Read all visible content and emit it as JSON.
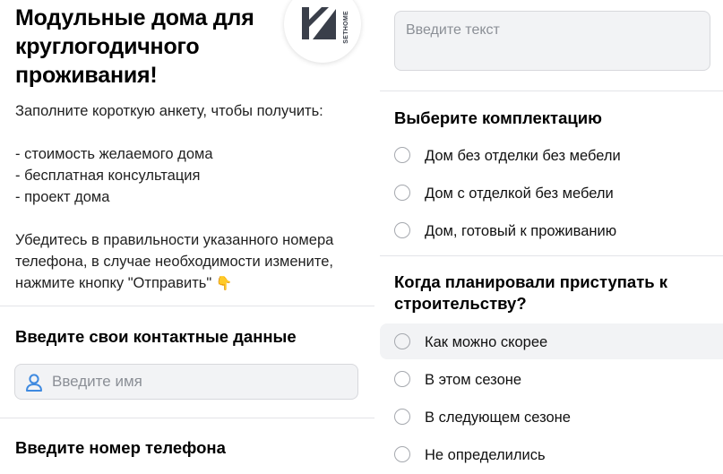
{
  "header": {
    "title": "Модульные дома для круглогодичного проживания!",
    "logo_text": "SETHOME",
    "logo_icon": "sethome-logo-icon"
  },
  "intro": {
    "lead": "Заполните короткую анкету, чтобы получить:",
    "bullets": [
      "- стоимость желаемого дома",
      "- бесплатная консультация",
      "- проект дома"
    ],
    "note": "Убедитесь в правильности указанного номера телефона, в случае необходимости измените, нажмите кнопку \"Отправить\"",
    "note_emoji": "👇"
  },
  "contact": {
    "title": "Введите свои контактные данные",
    "name_placeholder": "Введите имя",
    "name_icon": "user-icon"
  },
  "phone": {
    "title": "Введите номер телефона"
  },
  "comment": {
    "placeholder": "Введите текст"
  },
  "equipment": {
    "title": "Выберите комплектацию",
    "options": [
      "Дом без отделки без мебели",
      "Дом с отделкой без мебели",
      "Дом, готовый к проживанию"
    ]
  },
  "start": {
    "title": "Когда планировали приступать к строительству?",
    "options": [
      "Как можно скорее",
      "В этом сезоне",
      "В следующем сезоне",
      "Не определились"
    ]
  },
  "colors": {
    "accent": "#3f8ae0",
    "field_bg": "#f2f3f5",
    "divider": "#e3e4e8",
    "logo_dark": "#3a3f4a"
  }
}
